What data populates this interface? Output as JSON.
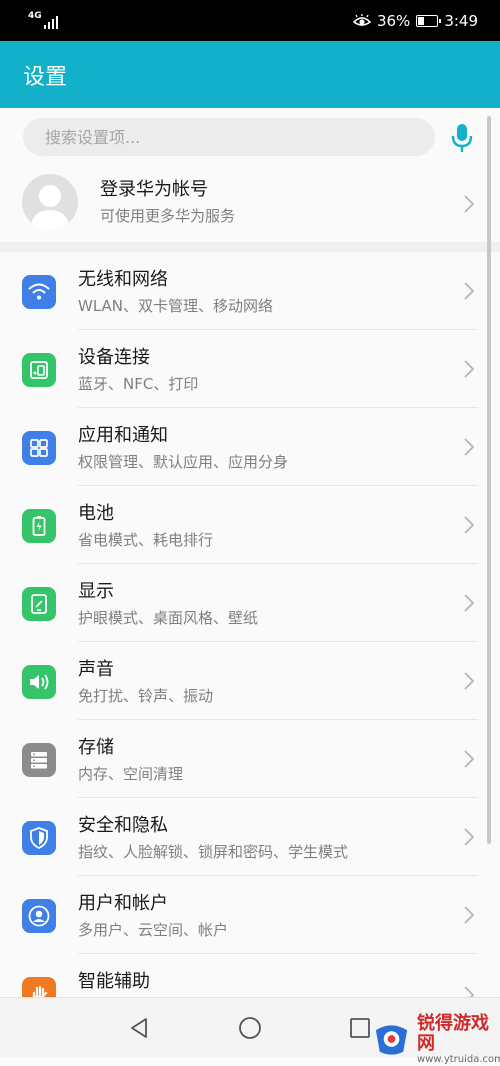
{
  "status_bar": {
    "network": "4G",
    "battery_percent": "36%",
    "battery_level": 0.36,
    "time": "3:49",
    "icons": [
      "signal-icon",
      "eye-comfort-icon",
      "battery-icon"
    ]
  },
  "header": {
    "title": "设置",
    "background": "#12b1c9"
  },
  "search": {
    "placeholder": "搜索设置项...",
    "value": "",
    "mic_color": "#12b1c9"
  },
  "account": {
    "title": "登录华为帐号",
    "subtitle": "可使用更多华为服务"
  },
  "items": [
    {
      "icon": "wifi-icon",
      "color": "#3f7fe6",
      "title": "无线和网络",
      "subtitle": "WLAN、双卡管理、移动网络"
    },
    {
      "icon": "device-connection-icon",
      "color": "#35c46a",
      "title": "设备连接",
      "subtitle": "蓝牙、NFC、打印"
    },
    {
      "icon": "apps-icon",
      "color": "#3f7fe6",
      "title": "应用和通知",
      "subtitle": "权限管理、默认应用、应用分身"
    },
    {
      "icon": "battery-icon",
      "color": "#35c46a",
      "title": "电池",
      "subtitle": "省电模式、耗电排行"
    },
    {
      "icon": "display-icon",
      "color": "#35c46a",
      "title": "显示",
      "subtitle": "护眼模式、桌面风格、壁纸"
    },
    {
      "icon": "sound-icon",
      "color": "#35c46a",
      "title": "声音",
      "subtitle": "免打扰、铃声、振动"
    },
    {
      "icon": "storage-icon",
      "color": "#8c8c8c",
      "title": "存储",
      "subtitle": "内存、空间清理"
    },
    {
      "icon": "security-shield-icon",
      "color": "#3f7fe6",
      "title": "安全和隐私",
      "subtitle": "指纹、人脸解锁、锁屏和密码、学生模式"
    },
    {
      "icon": "user-account-icon",
      "color": "#3f7fe6",
      "title": "用户和帐户",
      "subtitle": "多用户、云空间、帐户"
    },
    {
      "icon": "assist-hand-icon",
      "color": "#f07a22",
      "title": "智能辅助",
      "subtitle": ""
    }
  ],
  "nav_bar": {
    "buttons": [
      "back-icon",
      "home-icon",
      "recents-icon"
    ]
  },
  "watermark": {
    "name": "锐得游戏网",
    "url": "www.ytruida.com"
  }
}
